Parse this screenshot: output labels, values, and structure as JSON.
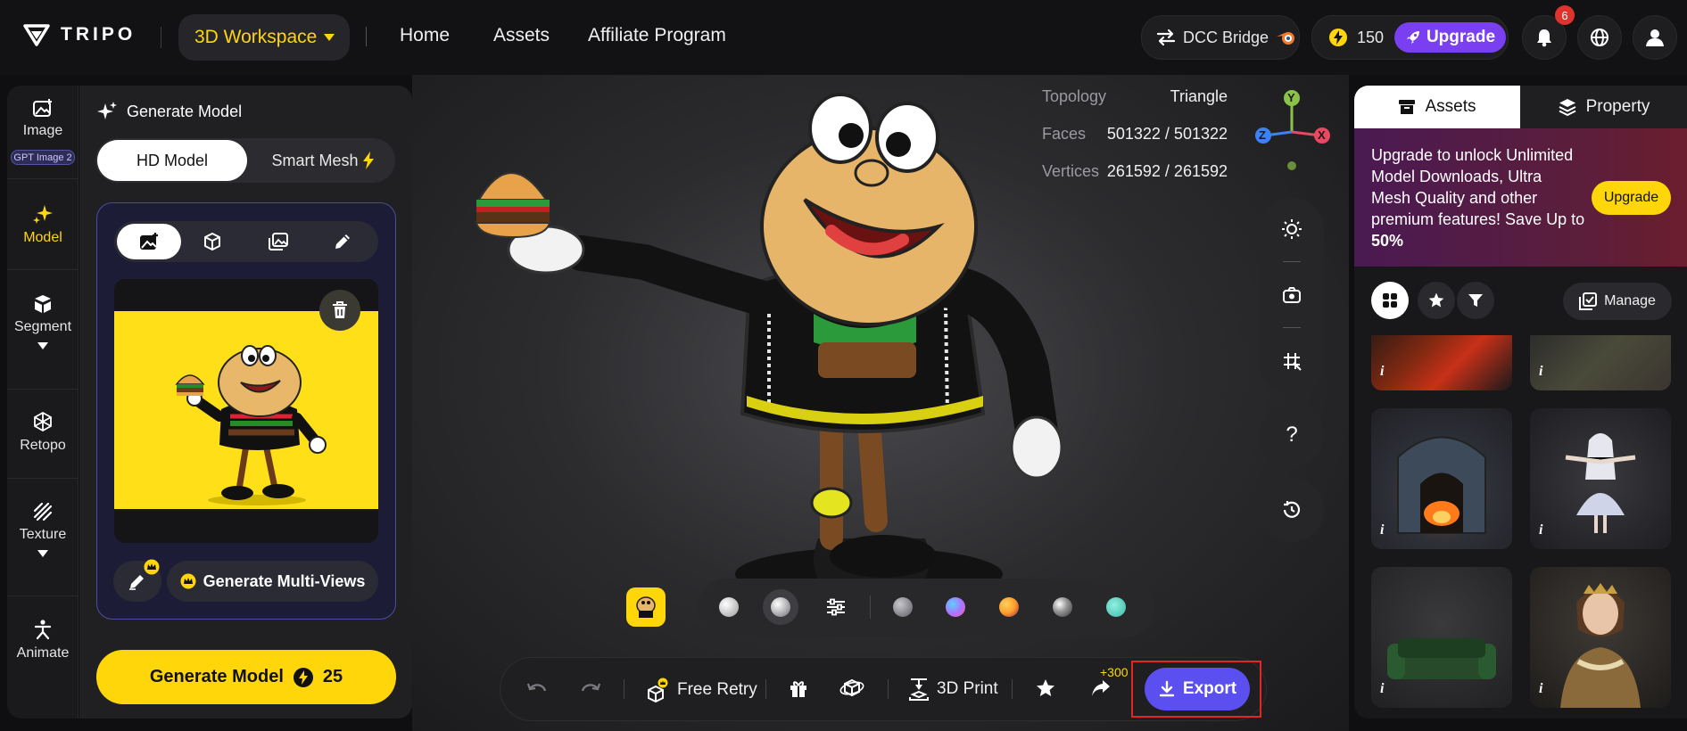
{
  "brand": {
    "name": "TRIPO"
  },
  "topbar": {
    "workspace_label": "3D Workspace",
    "nav": [
      "Home",
      "Assets",
      "Affiliate Program"
    ],
    "dcc_label": "DCC Bridge",
    "credits": "150",
    "upgrade_label": "Upgrade",
    "notification_count": "6"
  },
  "leftrail": {
    "items": [
      {
        "label": "Image",
        "tag": "GPT Image 2"
      },
      {
        "label": "Model"
      },
      {
        "label": "Segment"
      },
      {
        "label": "Retopo"
      },
      {
        "label": "Texture"
      },
      {
        "label": "Animate"
      }
    ],
    "active": "Model",
    "accent": "#ffd60a"
  },
  "panel": {
    "title": "Generate Model",
    "mode_on": "HD Model",
    "mode_off": "Smart Mesh",
    "multiview_label": "Generate Multi-Views",
    "generate_label": "Generate Model",
    "generate_cost": "25"
  },
  "viewport": {
    "stats": [
      {
        "label": "Topology",
        "value": "Triangle"
      },
      {
        "label": "Faces",
        "value": "501322 / 501322"
      },
      {
        "label": "Vertices",
        "value": "261592 / 261592"
      }
    ],
    "axis": {
      "x": "X",
      "y": "Y",
      "z": "Z"
    },
    "help": "?",
    "materials": [
      "#d8d8d8",
      "#b9b9bb",
      "#8c8c94",
      "#b070ff",
      "#ff9e2a",
      "#9a9a9a",
      "#5fd6c8"
    ]
  },
  "bottombar": {
    "free_retry": "Free Retry",
    "print": "3D Print",
    "share_bonus": "+300",
    "export_label": "Export",
    "export_color": "#5c4ff0"
  },
  "rightpanel": {
    "tab_assets": "Assets",
    "tab_property": "Property",
    "promo_text_pre": "Upgrade to unlock Unlimited Model Downloads, Ultra Mesh Quality and other premium features!  Save Up to ",
    "promo_text_bold": "50%",
    "promo_button": "Upgrade",
    "manage_label": "Manage",
    "info_glyph": "i"
  }
}
